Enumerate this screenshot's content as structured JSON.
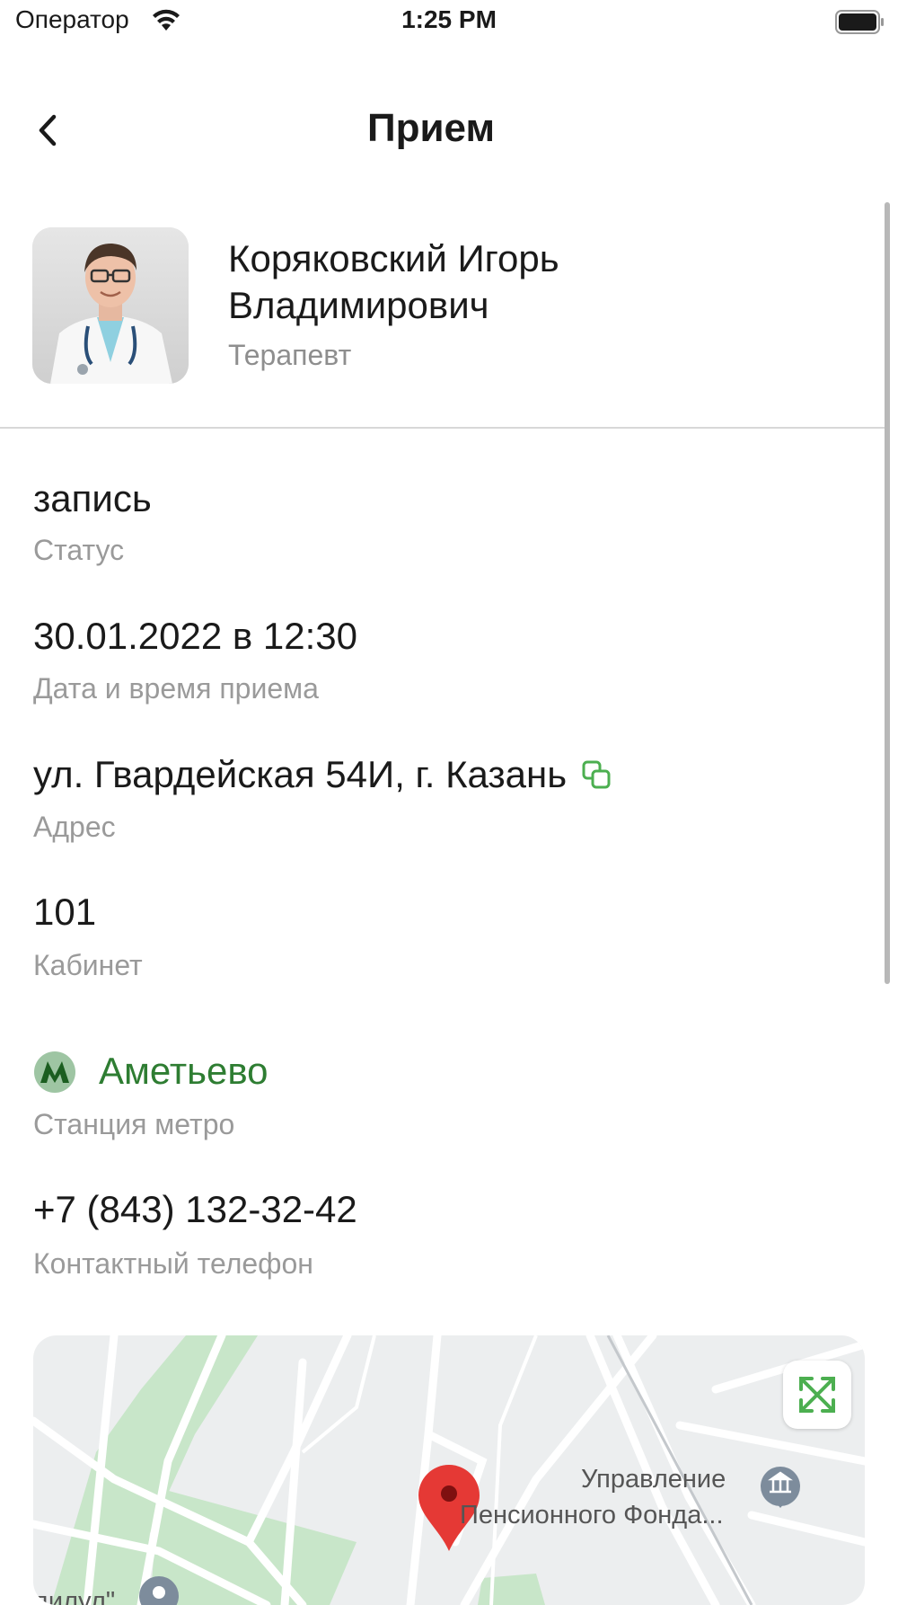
{
  "status_bar": {
    "carrier": "Оператор",
    "time": "1:25 PM"
  },
  "nav": {
    "title": "Прием",
    "back_icon": "chevron-left-icon"
  },
  "doctor": {
    "name": "Коряковский Игорь Владимирович",
    "specialty": "Терапевт"
  },
  "appointment": {
    "status_value": "запись",
    "status_label": "Статус",
    "datetime_value": "30.01.2022 в 12:30",
    "datetime_label": "Дата и время приема",
    "address_value": "ул. Гвардейская 54И, г. Казань",
    "address_label": "Адрес",
    "cabinet_value": "101",
    "cabinet_label": "Кабинет",
    "metro_value": "Аметьево",
    "metro_label": "Станция метро",
    "phone_value": "+7 (843) 132-32-42",
    "phone_label": "Контактный телефон"
  },
  "map": {
    "poi_1_line1": "Управление",
    "poi_1_line2": "Пенсионного Фонда...",
    "poi_2": "дилул\"",
    "expand_icon": "expand-icon"
  },
  "colors": {
    "accent_green": "#2e7d32",
    "copy_icon_green": "#4caf50",
    "metro_badge_bg": "#9ec5a3",
    "map_pin": "#e53935",
    "secondary_text": "#9a9a9a"
  }
}
